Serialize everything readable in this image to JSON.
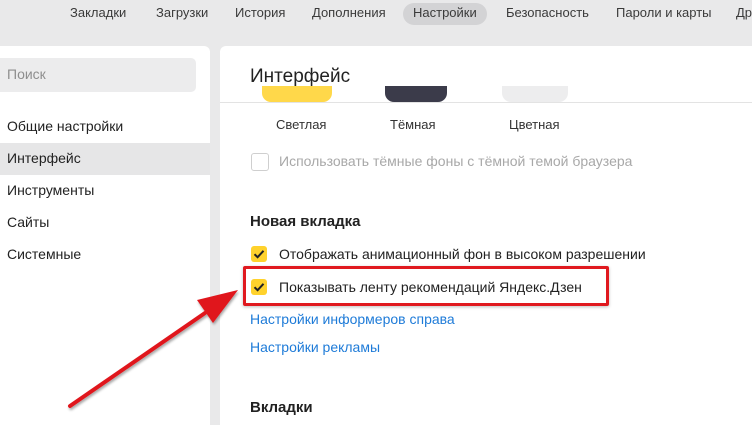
{
  "topnav": {
    "tabs": [
      {
        "label": "Закладки"
      },
      {
        "label": "Загрузки"
      },
      {
        "label": "История"
      },
      {
        "label": "Дополнения"
      },
      {
        "label": "Настройки"
      },
      {
        "label": "Безопасность"
      },
      {
        "label": "Пароли и карты"
      },
      {
        "label": "Др"
      }
    ],
    "active": "Настройки"
  },
  "sidebar": {
    "search_placeholder": "Поиск",
    "items": [
      {
        "label": "Общие настройки"
      },
      {
        "label": "Интерфейс"
      },
      {
        "label": "Инструменты"
      },
      {
        "label": "Сайты"
      },
      {
        "label": "Системные"
      }
    ],
    "active": "Интерфейс"
  },
  "main": {
    "title": "Интерфейс",
    "themes": [
      {
        "label": "Светлая",
        "color": "#ffd84a"
      },
      {
        "label": "Тёмная",
        "color": "#3b3b4a"
      },
      {
        "label": "Цветная",
        "color": "#ededee"
      }
    ],
    "dark_bg_option": {
      "label": "Использовать тёмные фоны с тёмной темой браузера",
      "checked": false,
      "disabled": true
    },
    "new_tab": {
      "heading": "Новая вкладка",
      "options": [
        {
          "label": "Отображать анимационный фон в высоком разрешении",
          "checked": true
        },
        {
          "label": "Показывать ленту рекомендаций Яндекс.Дзен",
          "checked": true
        }
      ],
      "links": [
        {
          "label": "Настройки информеров справа"
        },
        {
          "label": "Настройки рекламы"
        }
      ]
    },
    "tabs_heading": "Вкладки"
  },
  "colors": {
    "accent_checkbox": "#ffd22c",
    "link": "#1e7bd8",
    "annotation": "#e0191f"
  }
}
